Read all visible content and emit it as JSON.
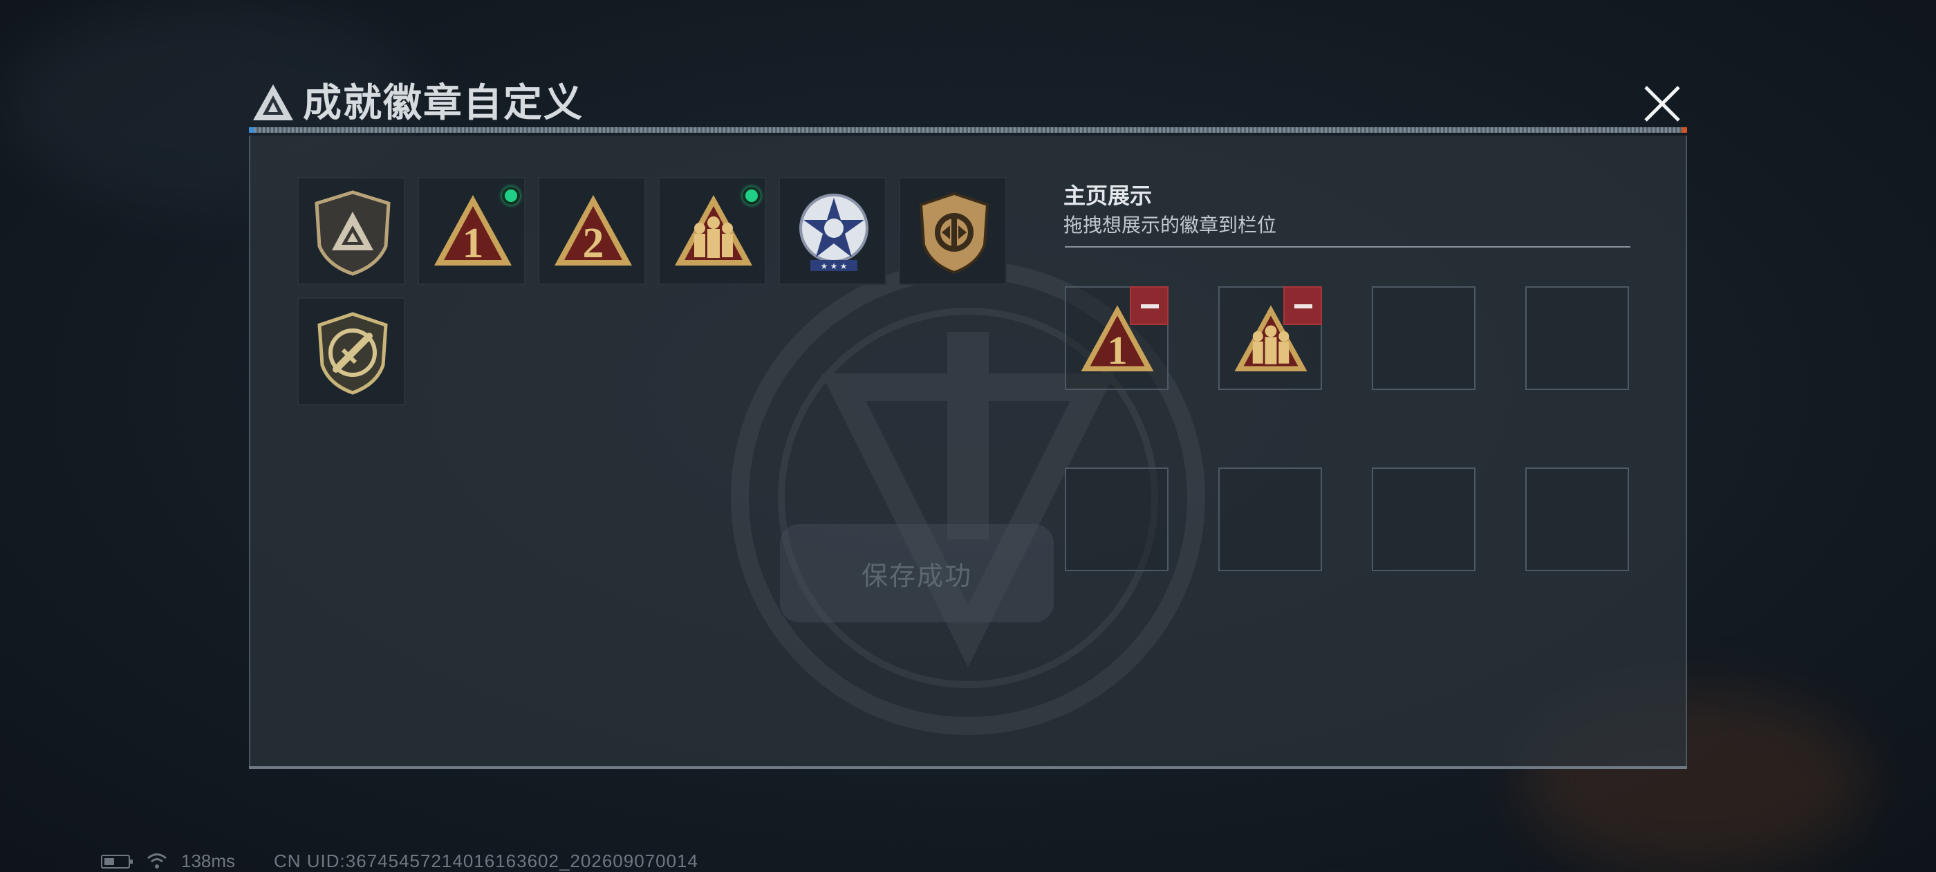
{
  "header": {
    "title": "成就徽章自定义",
    "close_icon": "close-icon"
  },
  "inventory": {
    "badges": [
      {
        "name": "tri-shield-badge",
        "new": false
      },
      {
        "name": "rank-1-badge",
        "label": "1",
        "new": true
      },
      {
        "name": "rank-2-badge",
        "label": "2",
        "new": false
      },
      {
        "name": "squad-badge",
        "new": true
      },
      {
        "name": "star-medal-badge",
        "new": false
      },
      {
        "name": "bronze-shield-badge",
        "new": false
      },
      {
        "name": "knife-shield-badge",
        "new": false
      }
    ]
  },
  "showcase": {
    "title": "主页展示",
    "subtitle": "拖拽想展示的徽章到栏位",
    "slots": [
      {
        "badge": "rank-1-badge",
        "label": "1"
      },
      {
        "badge": "squad-badge"
      },
      {
        "badge": null
      },
      {
        "badge": null
      },
      {
        "badge": null
      },
      {
        "badge": null
      },
      {
        "badge": null
      },
      {
        "badge": null
      }
    ]
  },
  "toast": {
    "text": "保存成功"
  },
  "status": {
    "ping": "138ms",
    "uid": "CN UID:36745457214016163602_202609070014"
  },
  "colors": {
    "accent_new": "#20d088",
    "remove": "#8c2a2f",
    "badge_gold": "#c9a35a",
    "badge_red": "#6b1f1c"
  }
}
